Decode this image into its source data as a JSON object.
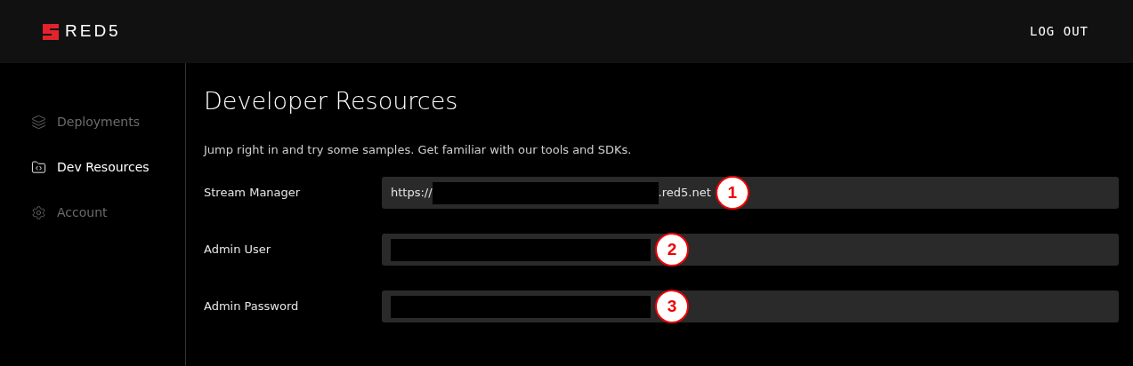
{
  "header": {
    "logo_text": "RED5",
    "logout": "LOG OUT"
  },
  "sidebar": {
    "items": [
      {
        "label": "Deployments",
        "kind": "stack",
        "selected": false
      },
      {
        "label": "Dev Resources",
        "kind": "folder",
        "selected": true
      },
      {
        "label": "Account",
        "kind": "gear",
        "selected": false
      }
    ]
  },
  "main": {
    "title": "Developer Resources",
    "subtitle": "Jump right in and try some samples. Get familiar with our tools and SDKs.",
    "fields": [
      {
        "label": "Stream Manager",
        "segments": [
          {
            "kind": "text",
            "text": "https://"
          },
          {
            "kind": "redacted"
          },
          {
            "kind": "text",
            "text": ".red5.net"
          }
        ],
        "callout": "1"
      },
      {
        "label": "Admin User",
        "segments": [
          {
            "kind": "redacted"
          }
        ],
        "callout": "2"
      },
      {
        "label": "Admin Password",
        "segments": [
          {
            "kind": "redacted"
          }
        ],
        "callout": "3"
      }
    ]
  }
}
